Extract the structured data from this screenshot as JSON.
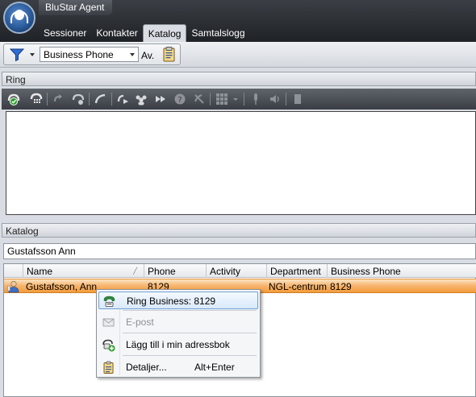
{
  "app": {
    "title": "BluStar Agent"
  },
  "tabs": [
    {
      "label": "Sessioner",
      "active": false
    },
    {
      "label": "Kontakter",
      "active": false
    },
    {
      "label": "Katalog",
      "active": true
    },
    {
      "label": "Samtalslogg",
      "active": false
    }
  ],
  "filter": {
    "selected": "Business Phone",
    "toggle_label": "Av."
  },
  "ring": {
    "title": "Ring"
  },
  "katalog": {
    "title": "Katalog",
    "search_value": "Gustafsson Ann",
    "columns": [
      "Name",
      "Phone",
      "Activity",
      "Department",
      "Business Phone"
    ],
    "rows": [
      {
        "name": "Gustafsson, Ann",
        "phone": "8129",
        "activity": "",
        "department": "NGL-centrum",
        "business_phone": "8129"
      }
    ]
  },
  "context_menu": {
    "items": [
      {
        "label": "Ring Business: 8129",
        "icon": "call-icon",
        "highlighted": true
      },
      {
        "label": "E-post",
        "icon": "email-icon",
        "disabled": true
      },
      {
        "label": "Lägg till i min adressbok",
        "icon": "add-contact-icon"
      },
      {
        "label": "Detaljer...",
        "shortcut": "Alt+Enter",
        "icon": "details-icon"
      }
    ]
  },
  "colors": {
    "accent_row": "#f7b46d",
    "header_dark": "#2b2e33",
    "highlight_border": "#6e9ed3"
  }
}
